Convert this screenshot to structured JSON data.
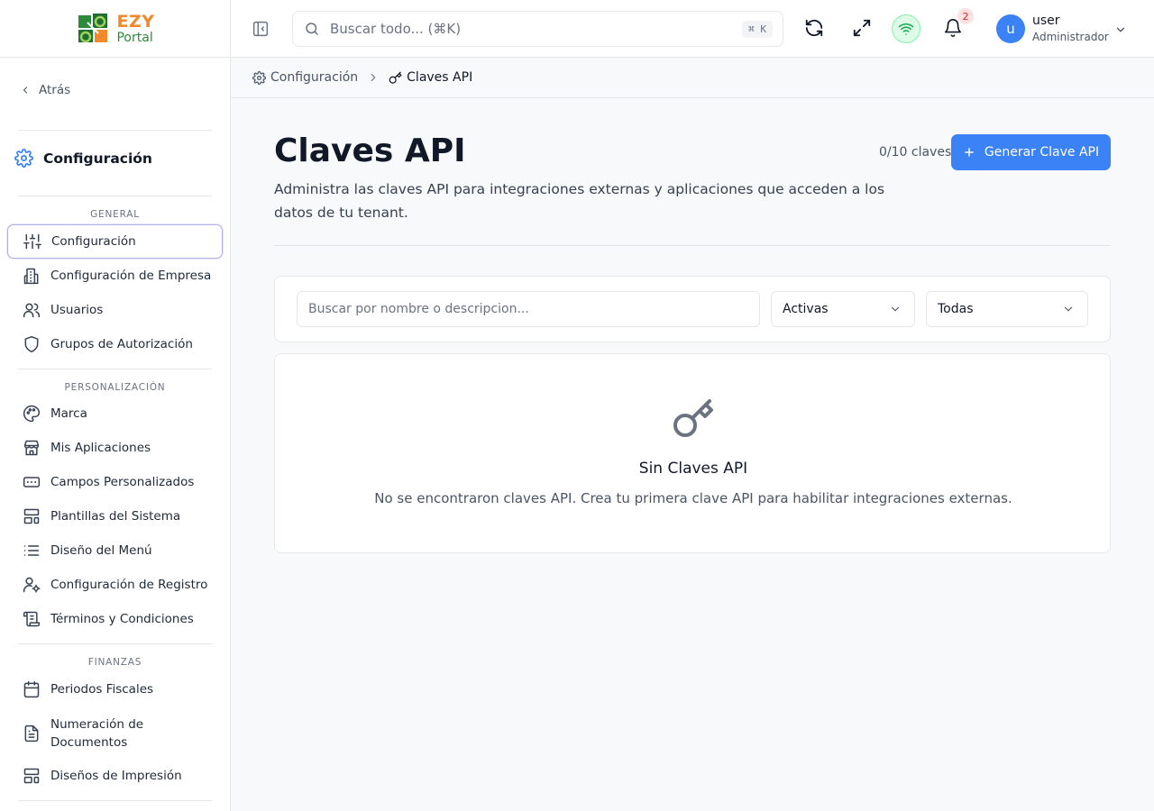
{
  "brand": {
    "name_top": "EZY",
    "name_bottom": "Portal",
    "orange": "#f08a2a",
    "green": "#2d8a3b"
  },
  "sidebar": {
    "back_label": "Atrás",
    "section_title": "Configuración",
    "groups": [
      {
        "heading": "GENERAL",
        "items": [
          "Configuración",
          "Configuración de Empresa",
          "Usuarios",
          "Grupos de Autorización"
        ]
      },
      {
        "heading": "PERSONALIZACIÓN",
        "items": [
          "Marca",
          "Mis Aplicaciones",
          "Campos Personalizados",
          "Plantillas del Sistema",
          "Diseño del Menú",
          "Configuración de Registro",
          "Términos y Condiciones"
        ]
      },
      {
        "heading": "FINANZAS",
        "items": [
          "Periodos Fiscales",
          "Numeración de Documentos",
          "Diseños de Impresión"
        ]
      }
    ],
    "active_item": "Configuración"
  },
  "header": {
    "search_placeholder": "Buscar todo... (⌘K)",
    "search_shortcut": "⌘ K",
    "notifications_count": "2",
    "user_initial": "u",
    "user_name": "user",
    "user_role": "Administrador",
    "status_color": "#16a34a"
  },
  "breadcrumb": {
    "parent": "Configuración",
    "current": "Claves API"
  },
  "main": {
    "title": "Claves API",
    "description": "Administra las claves API para integraciones externas y aplicaciones que acceden a los datos de tu tenant.",
    "count": "0/10 claves",
    "generate_button": "Generar Clave API",
    "accent": "#3b82f6",
    "filter": {
      "search_placeholder": "Buscar por nombre o descripcion...",
      "status_value": "Activas",
      "type_value": "Todas"
    },
    "empty": {
      "title": "Sin Claves API",
      "description": "No se encontraron claves API. Crea tu primera clave API para habilitar integraciones externas."
    }
  }
}
